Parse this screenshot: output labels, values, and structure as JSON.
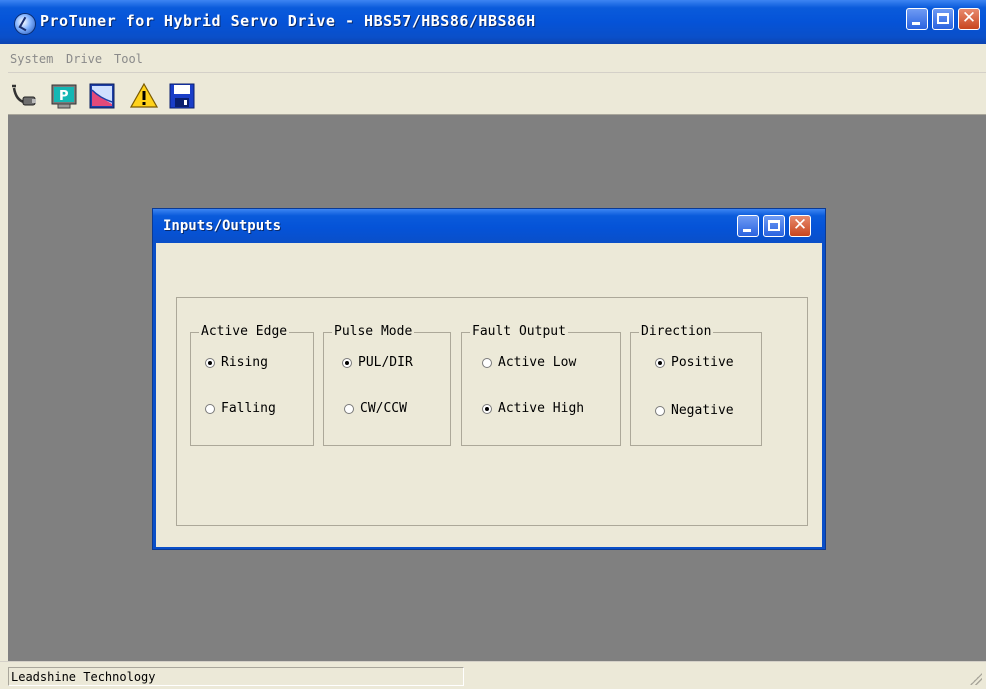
{
  "app": {
    "title": "ProTuner for Hybrid Servo Drive - HBS57/HBS86/HBS86H",
    "icon": "protuner-app-icon"
  },
  "menu": {
    "items": [
      "System",
      "Drive",
      "Tool"
    ]
  },
  "toolbar": {
    "icons": [
      "connect-icon",
      "parameter-icon",
      "chart-icon",
      "warning-icon",
      "save-icon"
    ]
  },
  "dialog": {
    "title": "Inputs/Outputs",
    "groups": {
      "active_edge": {
        "label": "Active Edge",
        "options": [
          "Rising",
          "Falling"
        ],
        "selected": "Rising"
      },
      "pulse_mode": {
        "label": "Pulse Mode",
        "options": [
          "PUL/DIR",
          "CW/CCW"
        ],
        "selected": "PUL/DIR"
      },
      "fault_output": {
        "label": "Fault Output",
        "options": [
          "Active Low",
          "Active High"
        ],
        "selected": "Active High"
      },
      "direction": {
        "label": "Direction",
        "options": [
          "Positive",
          "Negative"
        ],
        "selected": "Positive"
      }
    }
  },
  "status": {
    "text": "Leadshine Technology"
  },
  "colors": {
    "titlebar": "#0a5bdb",
    "close_button": "#c8461f",
    "client_area": "#808080",
    "window_face": "#ece9d8"
  }
}
